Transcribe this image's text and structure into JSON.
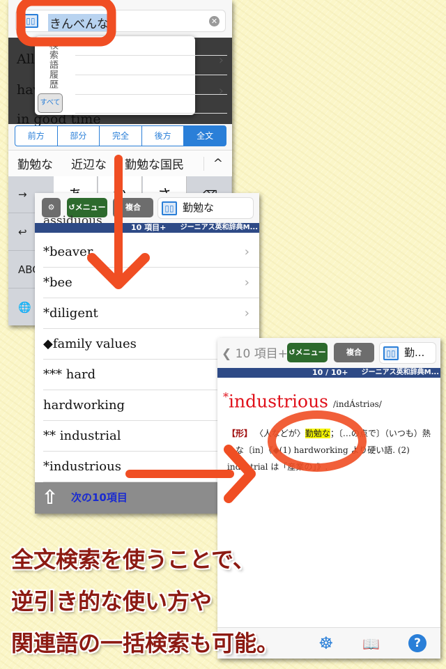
{
  "colors": {
    "accent_red": "#f04e23",
    "ios_blue": "#2a7fd8",
    "caption": "#8c1a12",
    "header_bar": "#2e4a86",
    "menu_green": "#2d6a2d"
  },
  "screen1": {
    "search_value": "きんべんな",
    "list_rows": [
      "All",
      "hav",
      "in good time"
    ],
    "history": {
      "label": "検索語履歴",
      "all_button": "すべて"
    },
    "segments": [
      "前方",
      "部分",
      "完全",
      "後方",
      "全文"
    ],
    "selected_segment": "全文",
    "suggestions": [
      "勤勉な",
      "近辺な",
      "勤勉な国民",
      "^"
    ],
    "keys": [
      "あ",
      "か",
      "さ"
    ],
    "side_keys": [
      "→",
      "↩",
      "ABC",
      "🌐"
    ]
  },
  "screen2": {
    "menu_label": "メニュー",
    "combined_label": "複合",
    "query": "勤勉な",
    "count": "10 項目+",
    "dictionary": "ジーニアス英和辞典M...",
    "partial_top": "assiduous",
    "rows": [
      {
        "label": "*beaver",
        "chevron": true
      },
      {
        "label": "*bee",
        "chevron": true
      },
      {
        "label": "*diligent",
        "chevron": true
      },
      {
        "label": "◆family values",
        "chevron": false
      },
      {
        "label": "*** hard",
        "chevron": false
      },
      {
        "label": "hardworking",
        "chevron": false
      },
      {
        "label": "** industrial",
        "chevron": false
      },
      {
        "label": "*industrious",
        "chevron": false
      }
    ],
    "next_label": "次の10項目"
  },
  "screen3": {
    "back_label": "10 項目+",
    "menu_label": "メニュー",
    "combined_label": "複合",
    "query": "勤...",
    "position": "10 / 10+",
    "dictionary": "ジーニアス英和辞典M...",
    "headword_mark": "*",
    "headword": "industrious",
    "pronunciation": "/indÁstriəs/",
    "pos": "【形】",
    "def_1": "〈人などが〉",
    "def_hl": "勤勉な",
    "def_2": "；〔…の点で〕（いつも）熱心な〔in〕《◆(1) hardworking より硬い語. (2) industrial は「産業の」》.",
    "tabs": [
      "helm-icon",
      "book-add-icon",
      "help-icon"
    ]
  },
  "caption": [
    "全文検索を使うことで、",
    "逆引き的な使い方や",
    "関連語の一括検索も可能。"
  ]
}
